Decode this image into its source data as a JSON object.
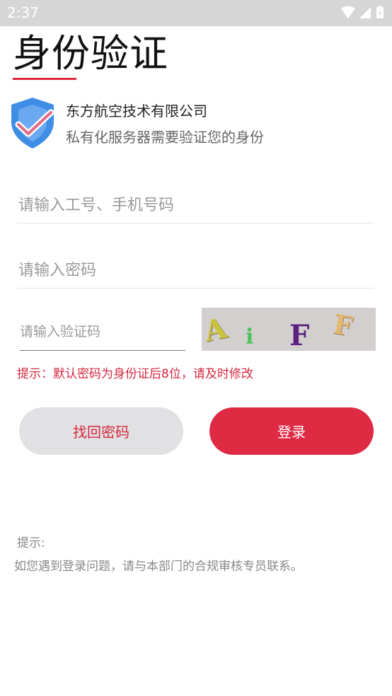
{
  "status_bar": {
    "time": "2:37"
  },
  "header": {
    "title": "身份验证"
  },
  "info": {
    "company": "东方航空技术有限公司",
    "subtitle": "私有化服务器需要验证您的身份"
  },
  "form": {
    "username_placeholder": "请输入工号、手机号码",
    "password_placeholder": "请输入密码",
    "captcha_placeholder": "请输入验证码",
    "captcha_chars": [
      "A",
      "i",
      "F",
      "F"
    ]
  },
  "hint": "提示：默认密码为身份证后8位，请及时修改",
  "buttons": {
    "recover": "找回密码",
    "login": "登录"
  },
  "note": {
    "title": "提示:",
    "body": "如您遇到登录问题，请与本部门的合规审核专员联系。"
  },
  "colors": {
    "accent": "#de2a43",
    "shield": "#3f8ee6",
    "status_bar_bg": "#d6d6d6"
  }
}
